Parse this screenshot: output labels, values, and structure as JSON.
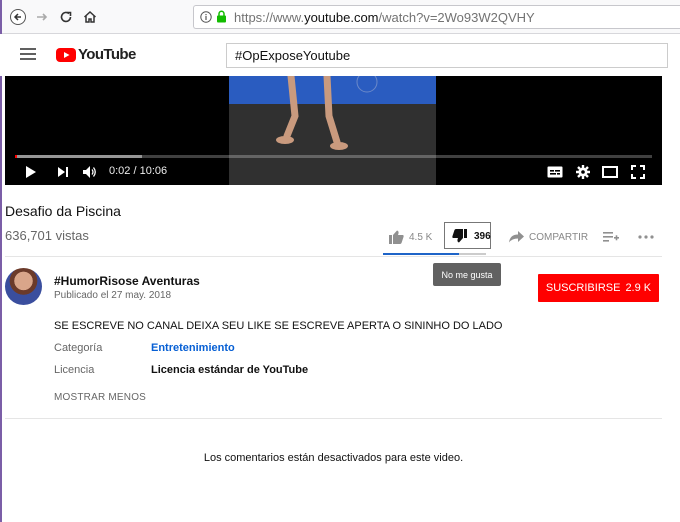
{
  "browser": {
    "url_prefix": "https://www.",
    "url_host": "youtube.com",
    "url_rest": "/watch?v=2Wo93W2QVHY"
  },
  "youtube": {
    "logo_text": "YouTube",
    "search_value": "#OpExposeYoutube"
  },
  "player": {
    "time": "0:02 / 10:06",
    "played_fraction": 0.003,
    "loaded_fraction": 0.2
  },
  "video": {
    "title": "Desafio da Piscina",
    "views": "636,701 vistas",
    "likes": "4.5 K",
    "dislikes": "396",
    "share_label": "COMPARTIR",
    "tooltip": "No me gusta",
    "like_ratio": 0.74
  },
  "channel": {
    "name": "#HumorRisose Aventuras",
    "published": "Publicado el 27 may. 2018",
    "subscribe_label": "SUSCRIBIRSE",
    "subscriber_count": "2.9 K"
  },
  "description": {
    "text": "SE ESCREVE NO CANAL DEIXA SEU LIKE SE ESCREVE APERTA O SININHO DO LADO",
    "category_label": "Categoría",
    "category_value": "Entretenimiento",
    "license_label": "Licencia",
    "license_value": "Licencia estándar de YouTube",
    "show_less": "MOSTRAR MENOS"
  },
  "comments": {
    "disabled_text": "Los comentarios están desactivados para este video."
  },
  "colors": {
    "brand_red": "#ff0000",
    "link_blue": "#065fd4",
    "like_bar": "#1e64c8"
  }
}
